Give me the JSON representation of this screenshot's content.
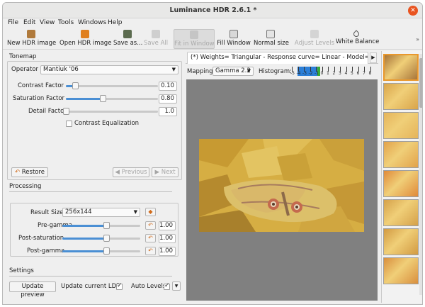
{
  "window": {
    "title": "Luminance HDR 2.6.1 *"
  },
  "menu": [
    "File",
    "Edit",
    "View",
    "Tools",
    "Windows",
    "Help"
  ],
  "toolbar": {
    "new_hdr": "New HDR image",
    "open_hdr": "Open HDR image",
    "save_as": "Save as...",
    "save_all": "Save All",
    "fit_window": "Fit in Window",
    "fill_window": "Fill Window",
    "normal_size": "Normal size",
    "adjust_levels": "Adjust Levels",
    "white_balance": "White Balance"
  },
  "tonemap": {
    "heading": "Tonemap",
    "operator_label": "Operator",
    "operator_value": "Mantiuk '06",
    "contrast_label": "Contrast Factor",
    "contrast_value": "0.10",
    "contrast_level": 0.1,
    "saturation_label": "Saturation Factor",
    "saturation_value": "0.80",
    "saturation_level": 0.4,
    "detail_label": "Detail Factor",
    "detail_value": "1.0",
    "detail_level": 0.0,
    "equalization_label": "Contrast Equalization",
    "equalization_checked": false,
    "restore_label": "Restore",
    "previous_label": "Previous",
    "next_label": "Next"
  },
  "processing": {
    "heading": "Processing",
    "result_size_label": "Result Size",
    "result_size_value": "256x144",
    "pregamma_label": "Pre-gamma",
    "pregamma_value": "1.00",
    "postsat_label": "Post-saturation",
    "postsat_value": "1.00",
    "postgamma_label": "Post-gamma",
    "postgamma_value": "1.00"
  },
  "settings": {
    "heading": "Settings",
    "update_preview": "Update preview",
    "update_ldr": "Update current LDR",
    "update_ldr_checked": true,
    "auto_levels": "Auto Levels",
    "auto_levels_checked": true
  },
  "viewer": {
    "tab_title": "(*) Weights= Triangular - Response curve= Linear - Model= Debevec",
    "mapping_label": "Mapping:",
    "mapping_value": "Gamma 2.2",
    "histogram_label": "Histogram:",
    "histogram_ticks": [
      "-5",
      "-4",
      "-3",
      "-2",
      "-1",
      "0",
      "1",
      "2",
      "3",
      "4",
      "5",
      "6",
      "7",
      "8"
    ]
  },
  "previews": {
    "count": 8
  },
  "colors": {
    "accent": "#e95420",
    "slider_fill": "#4a8fd4",
    "selected_thumb": "#e9982d"
  }
}
